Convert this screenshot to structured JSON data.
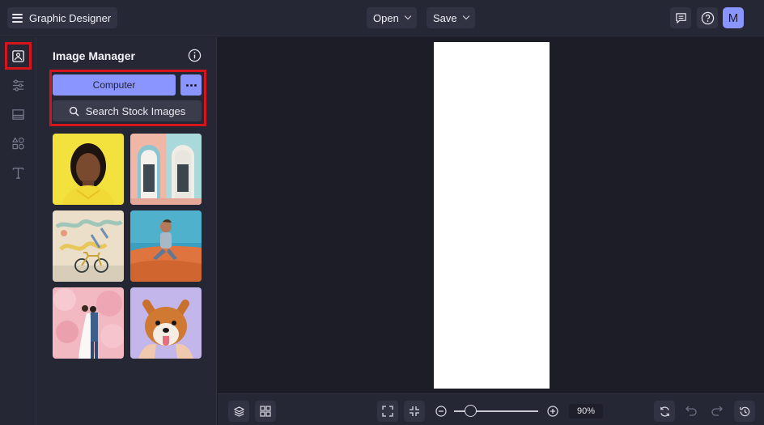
{
  "app": {
    "title": "Graphic Designer"
  },
  "header": {
    "open_label": "Open",
    "save_label": "Save",
    "avatar_initial": "M"
  },
  "sidebar": {
    "items": [
      {
        "icon": "image-icon",
        "active": true
      },
      {
        "icon": "sliders-icon",
        "active": false
      },
      {
        "icon": "background-icon",
        "active": false
      },
      {
        "icon": "shapes-icon",
        "active": false
      },
      {
        "icon": "text-icon",
        "active": false
      }
    ]
  },
  "panel": {
    "title": "Image Manager",
    "computer_label": "Computer",
    "search_label": "Search Stock Images",
    "thumbnails": [
      {
        "name": "thumb-portrait-woman"
      },
      {
        "name": "thumb-pink-doors"
      },
      {
        "name": "thumb-bicycle-mural"
      },
      {
        "name": "thumb-man-desert"
      },
      {
        "name": "thumb-couple-blossoms"
      },
      {
        "name": "thumb-shiba-dog"
      }
    ]
  },
  "zoom": {
    "value": "90%",
    "level": 0.2
  },
  "colors": {
    "accent": "#8b95ff",
    "highlight": "#d5141c",
    "background": "#1c1d27",
    "panel": "#262734"
  }
}
